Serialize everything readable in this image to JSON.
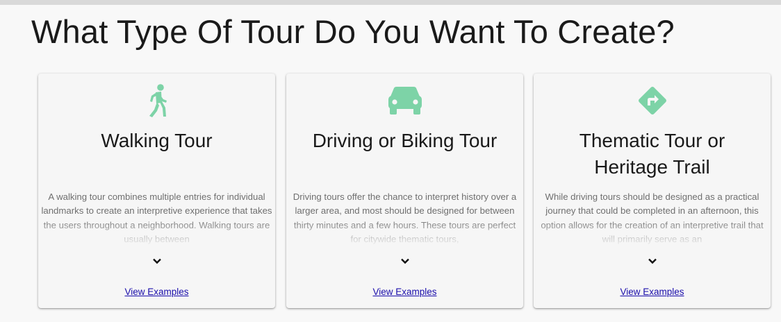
{
  "page": {
    "title": "What Type Of Tour Do You Want To Create?",
    "accent_color": "#7dd3a7",
    "link_color": "#1a0dab"
  },
  "cards": [
    {
      "icon": "walking-person-icon",
      "title": "Walking Tour",
      "description": "A walking tour combines multiple entries for individual landmarks to create an interpretive experience that takes the users throughout a neighborhood. Walking tours are usually between",
      "expand_icon": "chevron-down-icon",
      "link_label": "View Examples"
    },
    {
      "icon": "car-icon",
      "title": "Driving or Biking Tour",
      "description": "Driving tours offer the chance to interpret history over a larger area, and most should be designed for between thirty minutes and a few hours. These tours are perfect for citywide thematic tours,",
      "expand_icon": "chevron-down-icon",
      "link_label": "View Examples"
    },
    {
      "icon": "directions-sign-icon",
      "title": "Thematic Tour or Heritage Trail",
      "description": "While driving tours should be designed as a practical journey that could be completed in an afternoon, this option allows for the creation of an interpretive trail that will primarily serve as an",
      "expand_icon": "chevron-down-icon",
      "link_label": "View Examples"
    }
  ]
}
